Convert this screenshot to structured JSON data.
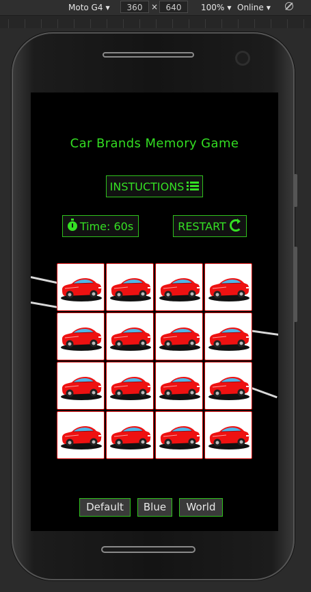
{
  "devtools": {
    "device": "Moto G4",
    "width": "360",
    "height": "640",
    "times": "×",
    "zoom": "100%",
    "network": "Online"
  },
  "game": {
    "title": "Car Brands Memory Game",
    "instructions_label": "INSTUCTIONS",
    "timer_label": "Time: 60s",
    "restart_label": "RESTART",
    "card_icon": "red-car-icon",
    "card_count": 16,
    "themes": [
      "Default",
      "Blue",
      "World"
    ]
  },
  "colors": {
    "accent": "#33dd22",
    "card_border": "#cc0000",
    "car": "#ee1111"
  }
}
